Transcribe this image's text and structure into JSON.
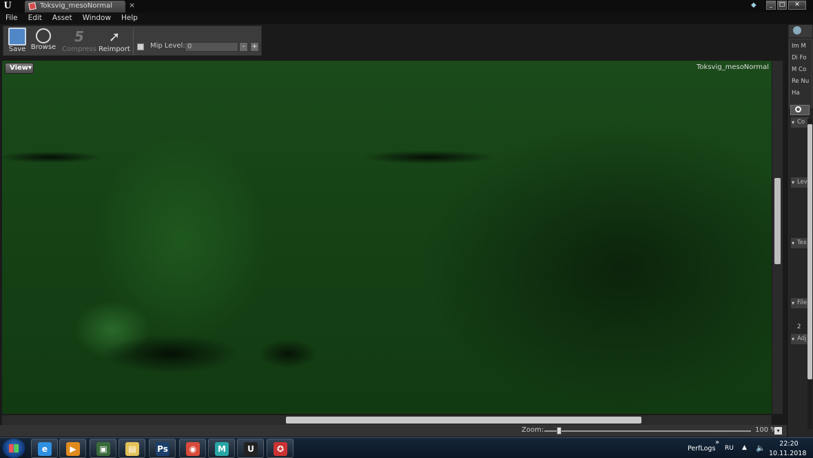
{
  "window": {
    "tab_title": "Toksvig_mesoNormal",
    "tab_close": "×",
    "app_logo": "U",
    "controls": [
      "_",
      "□",
      "✕"
    ]
  },
  "menu": [
    "File",
    "Edit",
    "Asset",
    "Window",
    "Help"
  ],
  "toolbar": {
    "save": "Save",
    "browse": "Browse",
    "compress": "Compress",
    "reimport": "Reimport",
    "compress_glyph": "5",
    "mip_label": "Mip Level:",
    "mip_value": "0",
    "mip_minus": "-",
    "mip_plus": "+"
  },
  "viewport": {
    "view_button": "View▾",
    "texture_name": "Toksvig_mesoNormal"
  },
  "status": {
    "zoom_label": "Zoom:",
    "zoom_value": "100 %",
    "zoom_dd": "▾"
  },
  "right_panel": {
    "rows": [
      "Im M",
      "Di Fo",
      "M Co",
      "Re Nu",
      "Ha"
    ],
    "sections": [
      "Co",
      "Lev",
      "Tex",
      "File",
      "Adj"
    ],
    "number": "2"
  },
  "taskbar": {
    "apps": [
      {
        "name": "ie",
        "glyph": "e",
        "color": "#2f8fe0"
      },
      {
        "name": "media",
        "glyph": "▶",
        "color": "#e08a1e"
      },
      {
        "name": "monitor",
        "glyph": "▣",
        "color": "#3a6a3a"
      },
      {
        "name": "explorer",
        "glyph": "▤",
        "color": "#e3c25a"
      },
      {
        "name": "photoshop",
        "glyph": "Ps",
        "color": "#1b3f6b"
      },
      {
        "name": "chrome",
        "glyph": "◉",
        "color": "#d84b3b"
      },
      {
        "name": "maya",
        "glyph": "M",
        "color": "#2aa6a6"
      },
      {
        "name": "unreal",
        "glyph": "U",
        "color": "#222"
      },
      {
        "name": "app",
        "glyph": "✪",
        "color": "#c33"
      }
    ],
    "tray_folder": "PerfLogs",
    "tray_chevron": "»",
    "language": "RU",
    "time": "22:20",
    "date": "10.11.2018"
  },
  "colors": {
    "viewport_green": "#1b4a1b",
    "chrome": "#3c3c3c"
  }
}
